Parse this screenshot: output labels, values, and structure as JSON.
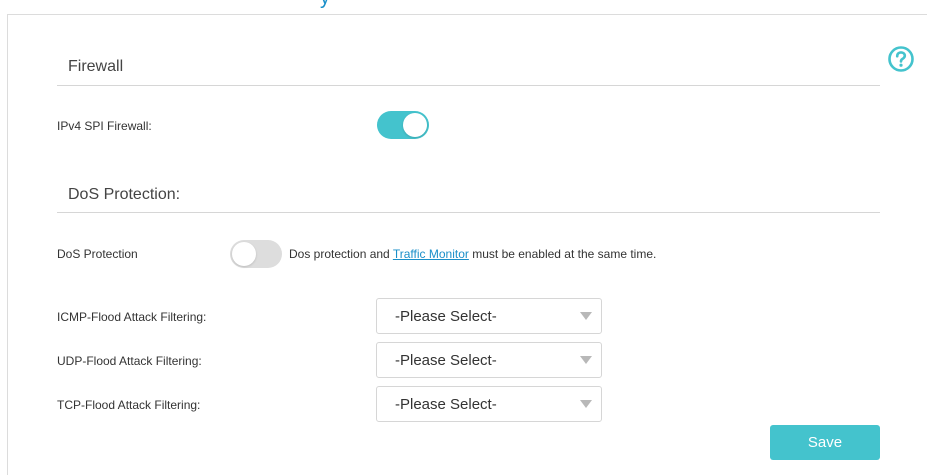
{
  "header": {
    "title_fragment": "y"
  },
  "firewall": {
    "section_title": "Firewall",
    "ipv4_spi_label": "IPv4 SPI Firewall:",
    "ipv4_spi_enabled": true
  },
  "dos": {
    "section_title": "DoS Protection:",
    "toggle_label": "DoS Protection",
    "toggle_enabled": false,
    "note_prefix": "Dos protection and ",
    "note_link": "Traffic Monitor",
    "note_suffix": " must be enabled at the same time.",
    "filters": [
      {
        "label": "ICMP-Flood Attack Filtering:",
        "selected": "-Please Select-"
      },
      {
        "label": "UDP-Flood Attack Filtering:",
        "selected": "-Please Select-"
      },
      {
        "label": "TCP-Flood Attack Filtering:",
        "selected": "-Please Select-"
      }
    ]
  },
  "actions": {
    "save_label": "Save"
  },
  "icons": {
    "help": "help-circle-icon",
    "dropdown": "caret-down-icon"
  },
  "colors": {
    "accent": "#44c3cd",
    "link": "#1a8fc9",
    "toggle_off": "#dddddd"
  }
}
